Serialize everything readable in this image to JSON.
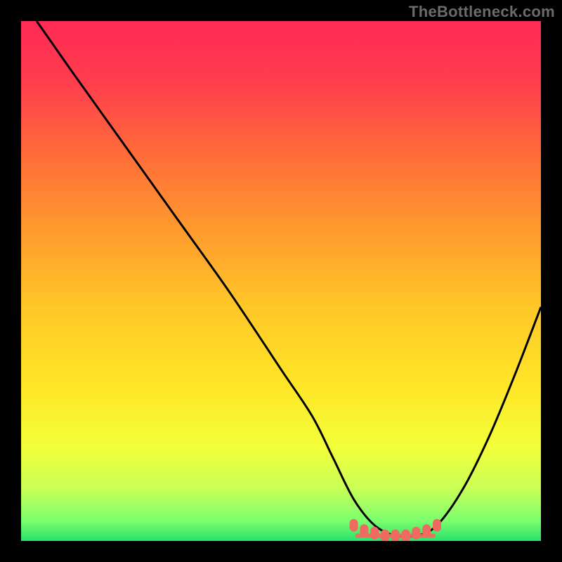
{
  "watermark": "TheBottleneck.com",
  "colors": {
    "background": "#000000",
    "curve": "#000000",
    "marker": "#f06a5f",
    "text": "#6b6b6b",
    "gradient_stops": [
      {
        "offset": 0.0,
        "color": "#ff2a55"
      },
      {
        "offset": 0.12,
        "color": "#ff3e4d"
      },
      {
        "offset": 0.25,
        "color": "#ff6a3a"
      },
      {
        "offset": 0.4,
        "color": "#ff9a2e"
      },
      {
        "offset": 0.55,
        "color": "#ffc728"
      },
      {
        "offset": 0.7,
        "color": "#ffe627"
      },
      {
        "offset": 0.82,
        "color": "#f3ff3a"
      },
      {
        "offset": 0.9,
        "color": "#c8ff57"
      },
      {
        "offset": 0.96,
        "color": "#7dff6e"
      },
      {
        "offset": 1.0,
        "color": "#29e26a"
      }
    ]
  },
  "chart_data": {
    "type": "line",
    "title": "",
    "xlabel": "",
    "ylabel": "",
    "xlim": [
      0,
      100
    ],
    "ylim": [
      0,
      100
    ],
    "grid": false,
    "legend_position": "none",
    "series": [
      {
        "name": "bottleneck-curve",
        "x": [
          3,
          10,
          20,
          30,
          40,
          50,
          56,
          60,
          64,
          68,
          72,
          76,
          80,
          85,
          90,
          95,
          100
        ],
        "y": [
          100,
          90,
          76,
          62,
          48,
          33,
          24,
          16,
          8,
          3,
          1,
          1,
          3,
          10,
          20,
          32,
          45
        ]
      }
    ],
    "flat_region": {
      "x_start": 64,
      "x_end": 80,
      "y": 2,
      "annotations": [
        "The curve drops steeply from top-left, reaches a broad minimum near x≈70–78 (y≈1–3), then rises again toward the right edge.",
        "Salmon-colored rounded markers sit along the flat bottom of the valley indicating the optimal / no-bottleneck zone."
      ]
    },
    "markers": {
      "name": "optimal-zone",
      "x": [
        64,
        66,
        68,
        70,
        72,
        74,
        76,
        78,
        80
      ],
      "y": [
        3,
        2,
        1.5,
        1,
        1,
        1,
        1.5,
        2,
        3
      ]
    }
  }
}
